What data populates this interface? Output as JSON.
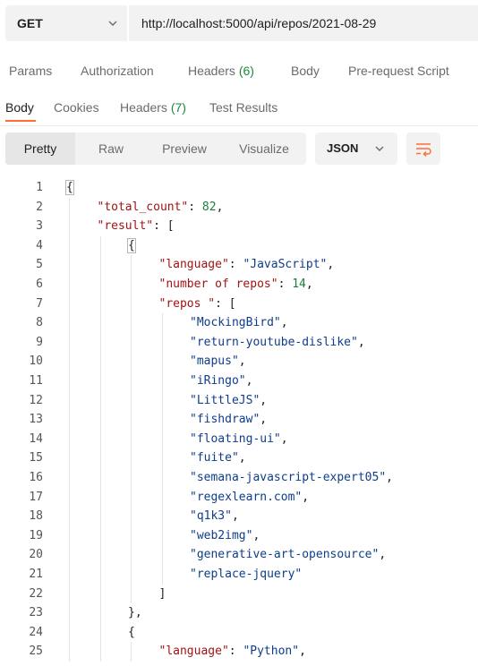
{
  "request": {
    "method": "GET",
    "url": "http://localhost:5000/api/repos/2021-08-29"
  },
  "request_tabs": [
    {
      "label": "Params",
      "count": ""
    },
    {
      "label": "Authorization",
      "count": ""
    },
    {
      "label": "Headers",
      "count": "(6)"
    },
    {
      "label": "Body",
      "count": ""
    },
    {
      "label": "Pre-request Script",
      "count": ""
    }
  ],
  "response_tabs": [
    {
      "label": "Body",
      "count": "",
      "active": true
    },
    {
      "label": "Cookies",
      "count": ""
    },
    {
      "label": "Headers",
      "count": "(7)"
    },
    {
      "label": "Test Results",
      "count": ""
    }
  ],
  "view_modes": [
    "Pretty",
    "Raw",
    "Preview",
    "Visualize"
  ],
  "active_view": "Pretty",
  "format": "JSON",
  "icons": {
    "method_dropdown": "chevron-down-icon",
    "format_dropdown": "chevron-down-icon",
    "wrap": "wrap-lines-icon"
  },
  "colors": {
    "accent": "#ff6c37",
    "key": "#a11313",
    "string": "#0e3d8a",
    "number": "#1a7d3e",
    "count": "#1a8a3f"
  },
  "code_lines": [
    {
      "n": 1,
      "indent": 0,
      "tokens": [
        {
          "t": "p",
          "v": "{"
        }
      ]
    },
    {
      "n": 2,
      "indent": 1,
      "tokens": [
        {
          "t": "k",
          "v": "\"total_count\""
        },
        {
          "t": "p",
          "v": ": "
        },
        {
          "t": "n",
          "v": "82"
        },
        {
          "t": "p",
          "v": ","
        }
      ]
    },
    {
      "n": 3,
      "indent": 1,
      "tokens": [
        {
          "t": "k",
          "v": "\"result\""
        },
        {
          "t": "p",
          "v": ": ["
        }
      ]
    },
    {
      "n": 4,
      "indent": 2,
      "tokens": [
        {
          "t": "p",
          "v": "{"
        }
      ]
    },
    {
      "n": 5,
      "indent": 3,
      "tokens": [
        {
          "t": "k",
          "v": "\"language\""
        },
        {
          "t": "p",
          "v": ": "
        },
        {
          "t": "s",
          "v": "\"JavaScript\""
        },
        {
          "t": "p",
          "v": ","
        }
      ]
    },
    {
      "n": 6,
      "indent": 3,
      "tokens": [
        {
          "t": "k",
          "v": "\"number of repos\""
        },
        {
          "t": "p",
          "v": ": "
        },
        {
          "t": "n",
          "v": "14"
        },
        {
          "t": "p",
          "v": ","
        }
      ]
    },
    {
      "n": 7,
      "indent": 3,
      "tokens": [
        {
          "t": "k",
          "v": "\"repos \""
        },
        {
          "t": "p",
          "v": ": ["
        }
      ]
    },
    {
      "n": 8,
      "indent": 4,
      "tokens": [
        {
          "t": "s",
          "v": "\"MockingBird\""
        },
        {
          "t": "p",
          "v": ","
        }
      ]
    },
    {
      "n": 9,
      "indent": 4,
      "tokens": [
        {
          "t": "s",
          "v": "\"return-youtube-dislike\""
        },
        {
          "t": "p",
          "v": ","
        }
      ]
    },
    {
      "n": 10,
      "indent": 4,
      "tokens": [
        {
          "t": "s",
          "v": "\"mapus\""
        },
        {
          "t": "p",
          "v": ","
        }
      ]
    },
    {
      "n": 11,
      "indent": 4,
      "tokens": [
        {
          "t": "s",
          "v": "\"iRingo\""
        },
        {
          "t": "p",
          "v": ","
        }
      ]
    },
    {
      "n": 12,
      "indent": 4,
      "tokens": [
        {
          "t": "s",
          "v": "\"LittleJS\""
        },
        {
          "t": "p",
          "v": ","
        }
      ]
    },
    {
      "n": 13,
      "indent": 4,
      "tokens": [
        {
          "t": "s",
          "v": "\"fishdraw\""
        },
        {
          "t": "p",
          "v": ","
        }
      ]
    },
    {
      "n": 14,
      "indent": 4,
      "tokens": [
        {
          "t": "s",
          "v": "\"floating-ui\""
        },
        {
          "t": "p",
          "v": ","
        }
      ]
    },
    {
      "n": 15,
      "indent": 4,
      "tokens": [
        {
          "t": "s",
          "v": "\"fuite\""
        },
        {
          "t": "p",
          "v": ","
        }
      ]
    },
    {
      "n": 16,
      "indent": 4,
      "tokens": [
        {
          "t": "s",
          "v": "\"semana-javascript-expert05\""
        },
        {
          "t": "p",
          "v": ","
        }
      ]
    },
    {
      "n": 17,
      "indent": 4,
      "tokens": [
        {
          "t": "s",
          "v": "\"regexlearn.com\""
        },
        {
          "t": "p",
          "v": ","
        }
      ]
    },
    {
      "n": 18,
      "indent": 4,
      "tokens": [
        {
          "t": "s",
          "v": "\"q1k3\""
        },
        {
          "t": "p",
          "v": ","
        }
      ]
    },
    {
      "n": 19,
      "indent": 4,
      "tokens": [
        {
          "t": "s",
          "v": "\"web2img\""
        },
        {
          "t": "p",
          "v": ","
        }
      ]
    },
    {
      "n": 20,
      "indent": 4,
      "tokens": [
        {
          "t": "s",
          "v": "\"generative-art-opensource\""
        },
        {
          "t": "p",
          "v": ","
        }
      ]
    },
    {
      "n": 21,
      "indent": 4,
      "tokens": [
        {
          "t": "s",
          "v": "\"replace-jquery\""
        }
      ]
    },
    {
      "n": 22,
      "indent": 3,
      "tokens": [
        {
          "t": "p",
          "v": "]"
        }
      ]
    },
    {
      "n": 23,
      "indent": 2,
      "tokens": [
        {
          "t": "p",
          "v": "},"
        }
      ]
    },
    {
      "n": 24,
      "indent": 2,
      "tokens": [
        {
          "t": "p",
          "v": "{"
        }
      ]
    },
    {
      "n": 25,
      "indent": 3,
      "tokens": [
        {
          "t": "k",
          "v": "\"language\""
        },
        {
          "t": "p",
          "v": ": "
        },
        {
          "t": "s",
          "v": "\"Python\""
        },
        {
          "t": "p",
          "v": ","
        }
      ]
    }
  ]
}
